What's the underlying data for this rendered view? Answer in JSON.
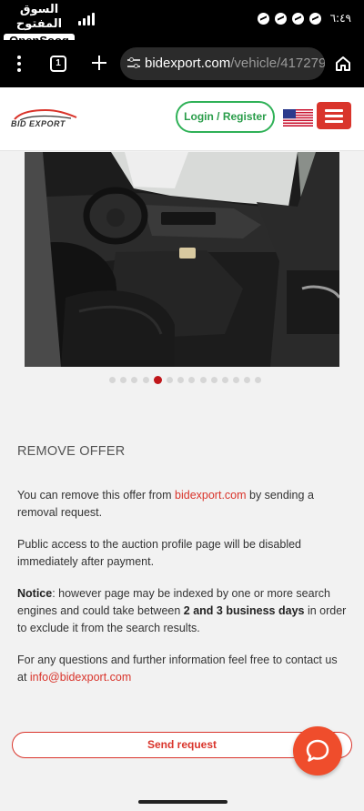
{
  "status_bar": {
    "brand_arabic": "السوق المفتوح",
    "brand_latin": "OpenSooq",
    "clock": "٦:٤٩",
    "notification_icons": [
      "messenger-icon",
      "messenger-icon",
      "messenger-icon",
      "messenger-icon"
    ]
  },
  "browser": {
    "tab_count": "1",
    "url_domain": "bidexport.com",
    "url_path": "/vehicle/417279"
  },
  "header": {
    "logo_text": "BID EXPORT",
    "login_label": "Login / Register",
    "brand_color": "#d9342b",
    "accent_green": "#2fb157"
  },
  "gallery": {
    "dot_count": 14,
    "active_index": 4
  },
  "remove_offer": {
    "title": "REMOVE OFFER",
    "p1_before": "You can remove this offer from ",
    "p1_link": "bidexport.com",
    "p1_after": " by sending a removal request.",
    "p2": "Public access to the auction profile page will be disabled immediately after payment.",
    "p3_notice": "Notice",
    "p3_a": ": however page may be indexed by one or more search engines and could take between ",
    "p3_bold": "2 and 3 business days",
    "p3_b": " in order to exclude it from the search results.",
    "p4_before": "For any questions and further information feel free to contact us at ",
    "p4_link": "info@bidexport.com",
    "send_label": "Send request"
  }
}
